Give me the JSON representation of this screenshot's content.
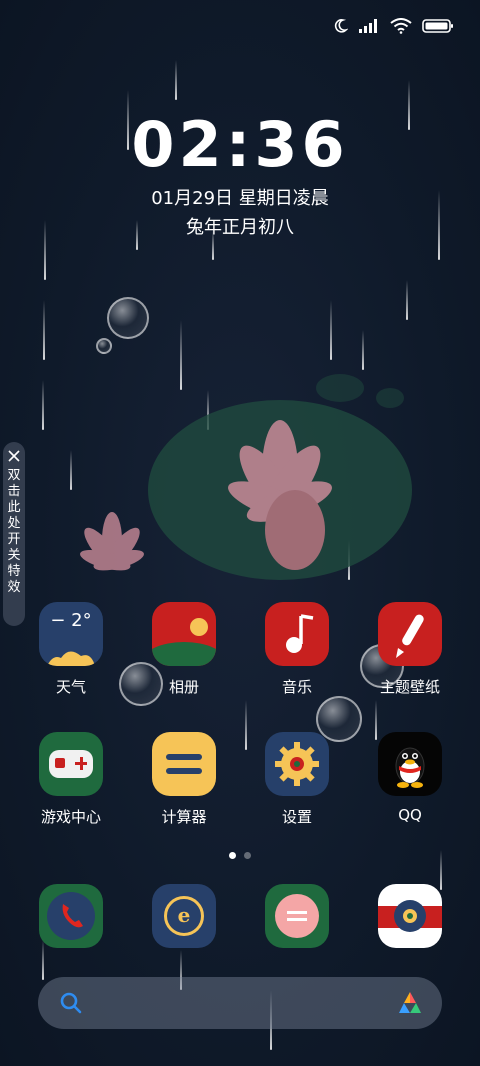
{
  "status_bar": {
    "icons": [
      "moon-icon",
      "signal-icon",
      "wifi-icon",
      "battery-icon"
    ]
  },
  "lockscreen": {
    "time": "02:36",
    "date": "01月29日 星期日凌晨",
    "lunar_date": "兔年正月初八"
  },
  "side_toggle": {
    "text": "双击此处开关特效",
    "icon": "close-icon"
  },
  "apps_row1": [
    {
      "label": "天气",
      "icon": "weather-icon",
      "temp": "− 2°"
    },
    {
      "label": "相册",
      "icon": "gallery-icon"
    },
    {
      "label": "音乐",
      "icon": "music-icon"
    },
    {
      "label": "主题壁纸",
      "icon": "theme-brush-icon"
    }
  ],
  "apps_row2": [
    {
      "label": "游戏中心",
      "icon": "gamepad-icon"
    },
    {
      "label": "计算器",
      "icon": "calculator-icon"
    },
    {
      "label": "设置",
      "icon": "settings-gear-icon"
    },
    {
      "label": "QQ",
      "icon": "qq-penguin-icon"
    }
  ],
  "page_indicator": {
    "pages": 2,
    "current": 1
  },
  "dock": [
    {
      "icon": "phone-icon"
    },
    {
      "icon": "browser-icon"
    },
    {
      "icon": "messages-icon"
    },
    {
      "icon": "camera-icon"
    }
  ],
  "search_bar": {
    "left_icon": "search-icon",
    "right_icon": "assistant-icon"
  },
  "colors": {
    "background": "#0f1a2a",
    "weather": "#27406a",
    "gallery_red": "#c8201f",
    "music_red": "#c8201f",
    "game_green": "#1f6a3e",
    "calculator_yellow": "#f6c457",
    "settings_blue": "#26406a",
    "dock_green": "#1f6a3e"
  }
}
